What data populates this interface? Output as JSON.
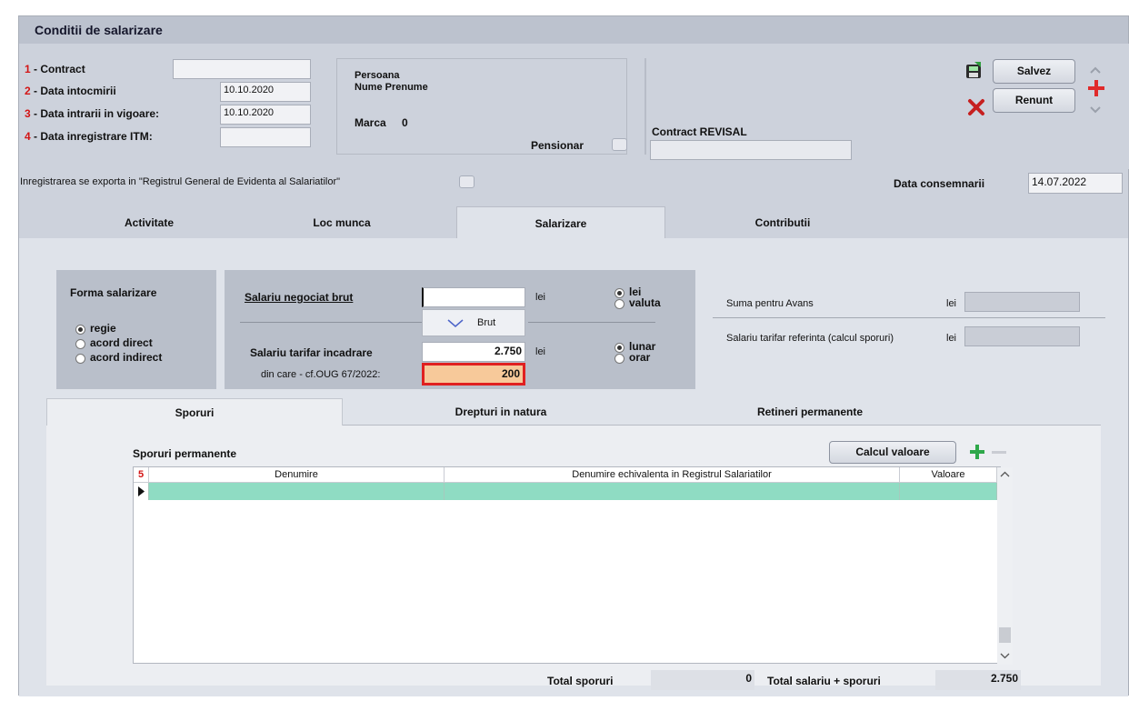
{
  "window": {
    "title": "Conditii de salarizare"
  },
  "header": {
    "contract": {
      "num": "1",
      "label": " - Contract",
      "value": ""
    },
    "data_intocmirii": {
      "num": "2",
      "label": " - Data intocmirii",
      "value": "10.10.2020"
    },
    "data_intrarii": {
      "num": "3",
      "label": " - Data intrarii in vigoare:",
      "value": "10.10.2020"
    },
    "data_itm": {
      "num": "4",
      "label": " - Data inregistrare ITM:",
      "value": ""
    },
    "persoana_label": "Persoana",
    "nume_prenume": "Nume Prenume",
    "marca_label": "Marca",
    "marca_value": "0",
    "pensionar_label": "Pensionar",
    "contract_revisal_label": "Contract REVISAL",
    "contract_revisal_value": "",
    "salvez_label": "Salvez",
    "renunt_label": "Renunt",
    "registru_text": "Inregistrarea se exporta in \"Registrul General de Evidenta al Salariatilor\"",
    "data_consemnarii_label": "Data consemnarii",
    "data_consemnarii_value": "14.07.2022"
  },
  "tabs": [
    {
      "label": "Activitate",
      "selected": false
    },
    {
      "label": "Loc munca",
      "selected": false
    },
    {
      "label": "Salarizare",
      "selected": true
    },
    {
      "label": "Contributii",
      "selected": false
    }
  ],
  "salarizare": {
    "forma_label": "Forma salarizare",
    "forma_options": [
      "regie",
      "acord direct",
      "acord indirect"
    ],
    "forma_selected": "regie",
    "salariu_negociat_label": "Salariu negociat brut",
    "salariu_negociat_value": "",
    "dropdown_option": "Brut",
    "unit_lei": "lei",
    "moneda_options": [
      "lei",
      "valuta"
    ],
    "moneda_selected": "lei",
    "salariu_tarifar_label": "Salariu tarifar incadrare",
    "salariu_tarifar_value": "2.750",
    "din_care_label": "din care - cf.OUG 67/2022:",
    "din_care_value": "200",
    "perioada_options": [
      "lunar",
      "orar"
    ],
    "perioada_selected": "lunar",
    "suma_avans_label": "Suma pentru Avans",
    "suma_avans_unit": "lei",
    "suma_avans_value": "",
    "salariu_referinta_label": "Salariu tarifar referinta (calcul sporuri)",
    "salariu_referinta_unit": "lei",
    "salariu_referinta_value": ""
  },
  "subtabs": [
    {
      "label": "Sporuri",
      "selected": true
    },
    {
      "label": "Drepturi in natura",
      "selected": false
    },
    {
      "label": "Retineri permanente",
      "selected": false
    }
  ],
  "sporuri": {
    "section_label": "Sporuri permanente",
    "calcul_button": "Calcul valoare",
    "grid_num": "5",
    "columns": [
      "Denumire",
      "Denumire echivalenta in Registrul Salariatilor",
      "Valoare"
    ],
    "rows": [
      {
        "denumire": "",
        "echivalenta": "",
        "valoare": ""
      }
    ],
    "total_sporuri_label": "Total sporuri",
    "total_sporuri_value": "0",
    "total_salariu_label": "Total salariu + sporuri",
    "total_salariu_value": "2.750"
  },
  "colors": {
    "required_number": "#d31515",
    "grid_row": "#8fdcc3",
    "highlight_field": "#f7c99a",
    "highlight_border": "#e02020"
  }
}
